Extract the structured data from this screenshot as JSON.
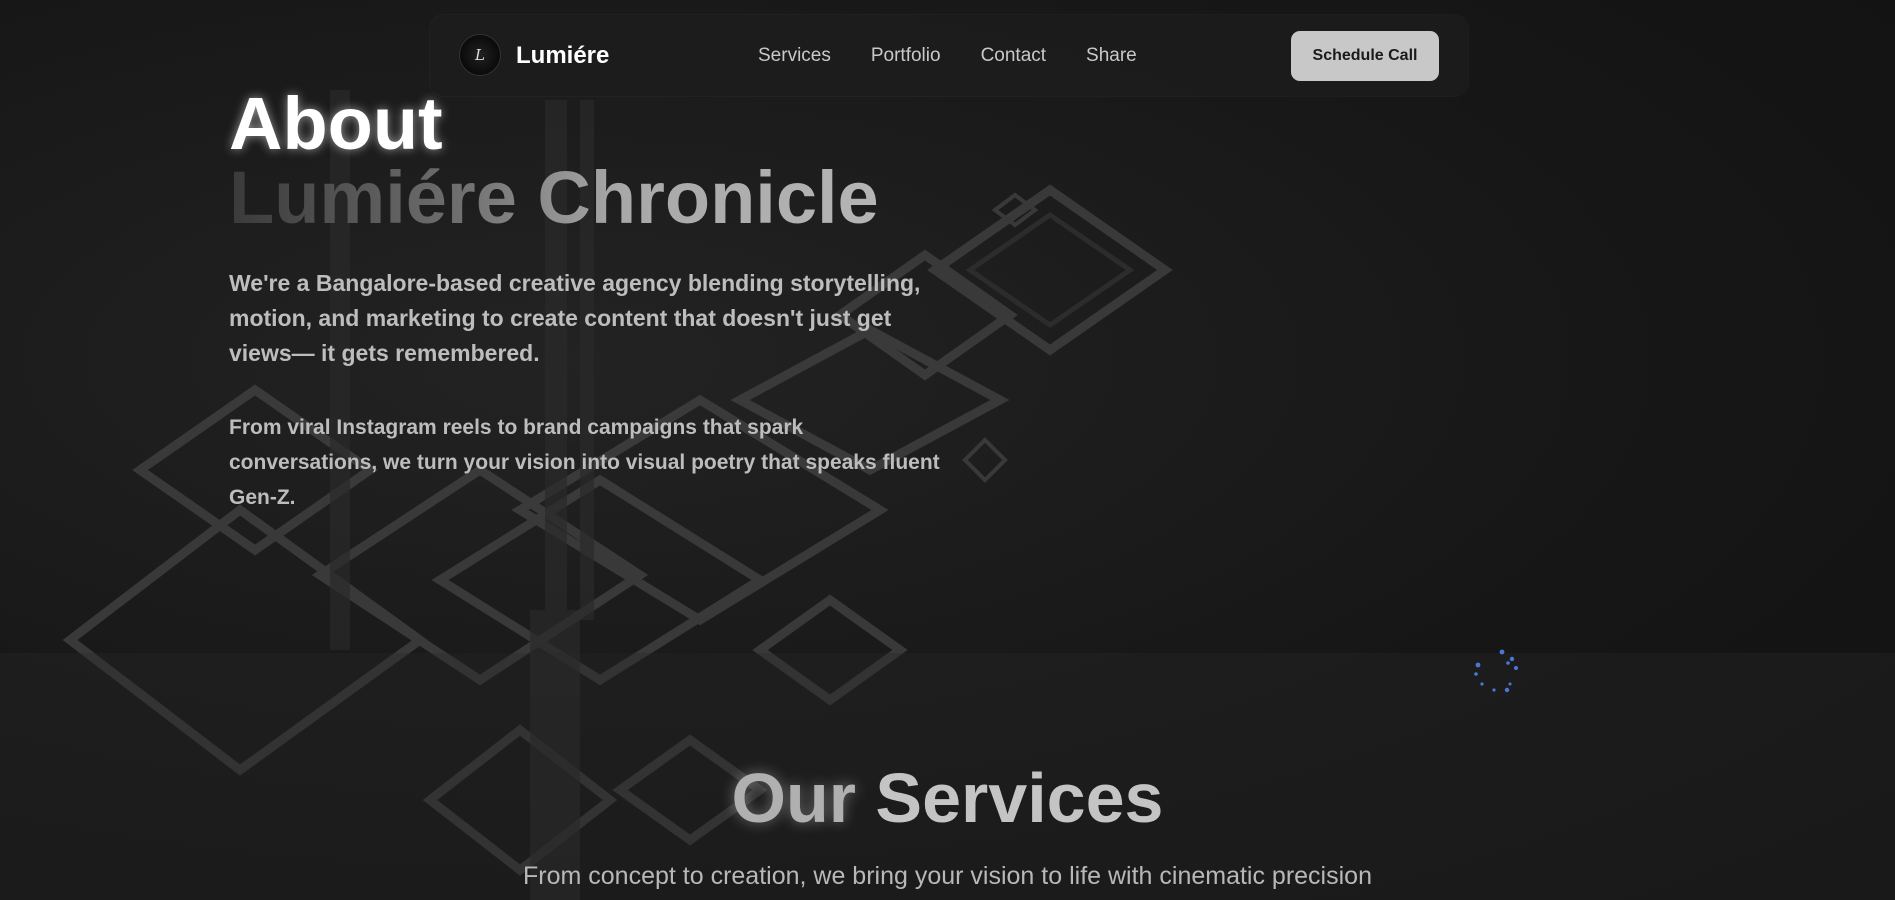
{
  "nav": {
    "brand": "Lumiére",
    "logo_glyph": "L",
    "links": [
      "Services",
      "Portfolio",
      "Contact",
      "Share"
    ],
    "cta_label": "Schedule Call"
  },
  "about": {
    "title": "About",
    "subtitle": "Lumiére Chronicle",
    "paragraph1": "We're a Bangalore-based creative agency blending storytelling, motion, and marketing to create content that doesn't just get views— it gets remembered.",
    "paragraph2": "From viral Instagram reels to brand campaigns that spark conversations, we turn your vision into visual poetry that speaks fluent Gen-Z."
  },
  "services": {
    "title_word1": "Our",
    "title_word2": "Services",
    "subtitle": "From concept to creation, we bring your vision to life with cinematic precision"
  },
  "icons": {
    "loading": "loading-spinner-icon",
    "logo": "logo-icon"
  },
  "colors": {
    "background": "#141414",
    "cta_background": "#c8c8c8",
    "spinner": "#4a78d8"
  }
}
